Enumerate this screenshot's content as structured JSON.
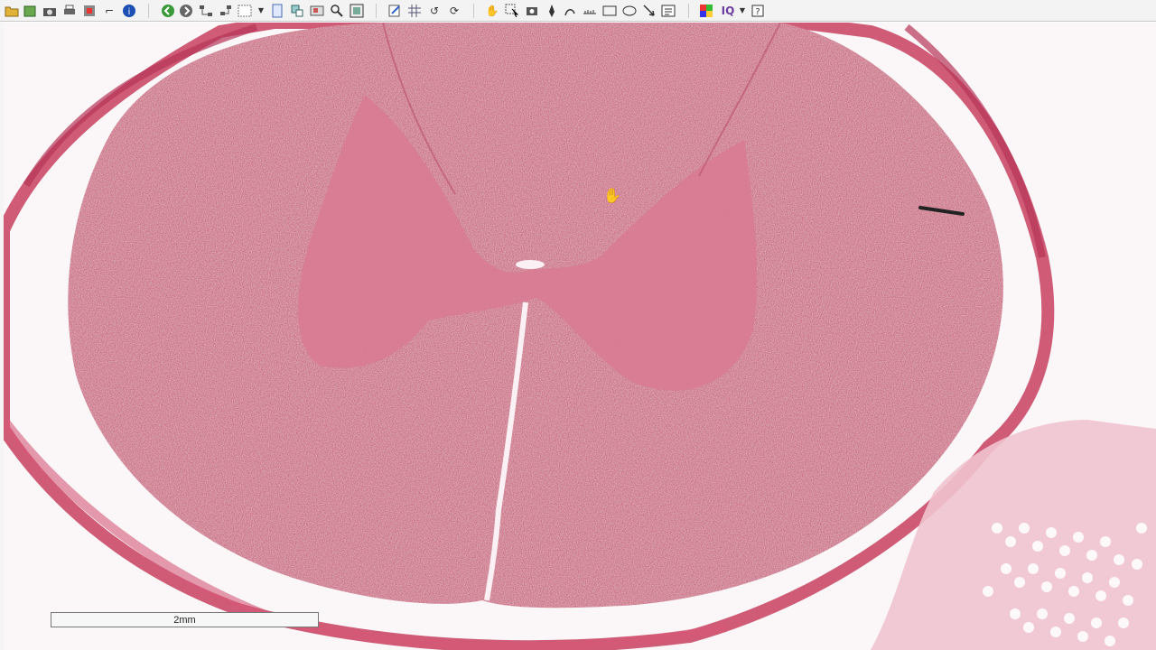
{
  "toolbar": {
    "icons": [
      "open-folder-icon",
      "open-file-icon",
      "camera-icon",
      "print-icon",
      "export-icon",
      "crop-icon",
      "info-icon",
      "back-icon",
      "forward-icon",
      "tree-icon",
      "network-icon",
      "region-select-icon",
      "dropdown-icon",
      "page-icon",
      "overview-icon",
      "slide-icon",
      "magnifier-icon",
      "fit-icon",
      "annotation-edit-icon",
      "grid-icon",
      "rotate-icon",
      "sync-icon",
      "hand-pan-icon",
      "select-arrow-icon",
      "capture-icon",
      "pen-icon",
      "freehand-icon",
      "ruler-icon",
      "rectangle-icon",
      "ellipse-icon",
      "arrow-icon",
      "text-box-icon",
      "color-adjust-icon",
      "iq-icon",
      "iq-dropdown-icon",
      "help-icon"
    ],
    "iq_label": "IQ"
  },
  "slide": {
    "scale_bar_label": "2mm",
    "stain_colors": {
      "background": "#fbf7f8",
      "white_matter": "#c95f7b",
      "gray_matter": "#d87b93",
      "meninges": "#c23f5f",
      "adipose": "#f0c3cf"
    }
  }
}
